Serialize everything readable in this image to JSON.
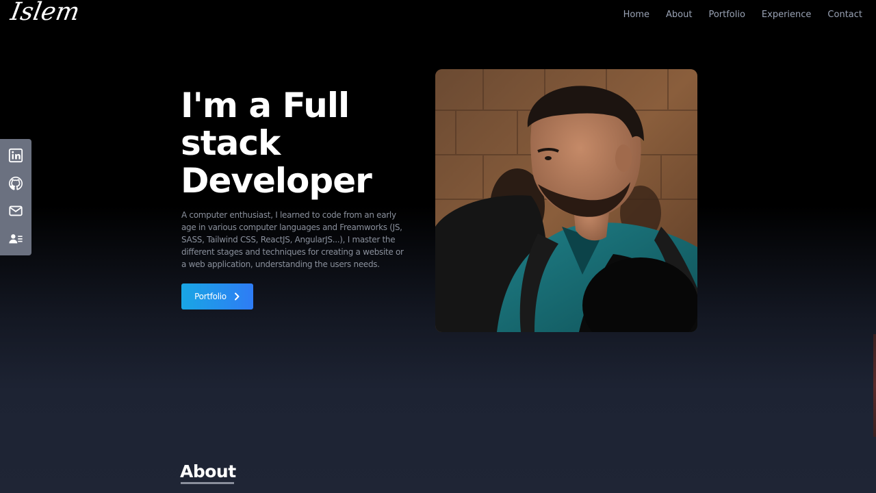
{
  "brand": {
    "logo_text": "Islem"
  },
  "nav": {
    "items": [
      {
        "label": "Home"
      },
      {
        "label": "About"
      },
      {
        "label": "Portfolio"
      },
      {
        "label": "Experience"
      },
      {
        "label": "Contact"
      }
    ]
  },
  "social": {
    "items": [
      {
        "icon": "linkedin-icon"
      },
      {
        "icon": "github-icon"
      },
      {
        "icon": "mail-icon"
      },
      {
        "icon": "contact-card-icon"
      }
    ],
    "bar_color": "#6b7180"
  },
  "hero": {
    "title": "I'm a Full stack Developer",
    "description": "A computer enthusiast, I learned to code from an early age in various computer languages and Freamworks (JS, SASS, Tailwind CSS, ReactJS, AngularJS...), I master the different stages and techniques for creating a website or a web application, understanding the users needs.",
    "cta_label": "Portfolio",
    "cta_icon": "chevron-right-icon"
  },
  "about": {
    "heading": "About"
  },
  "colors": {
    "accent_start": "#19a6e4",
    "accent_end": "#2e7cf5",
    "background_top": "#000000",
    "background_bottom": "#1f2535"
  }
}
